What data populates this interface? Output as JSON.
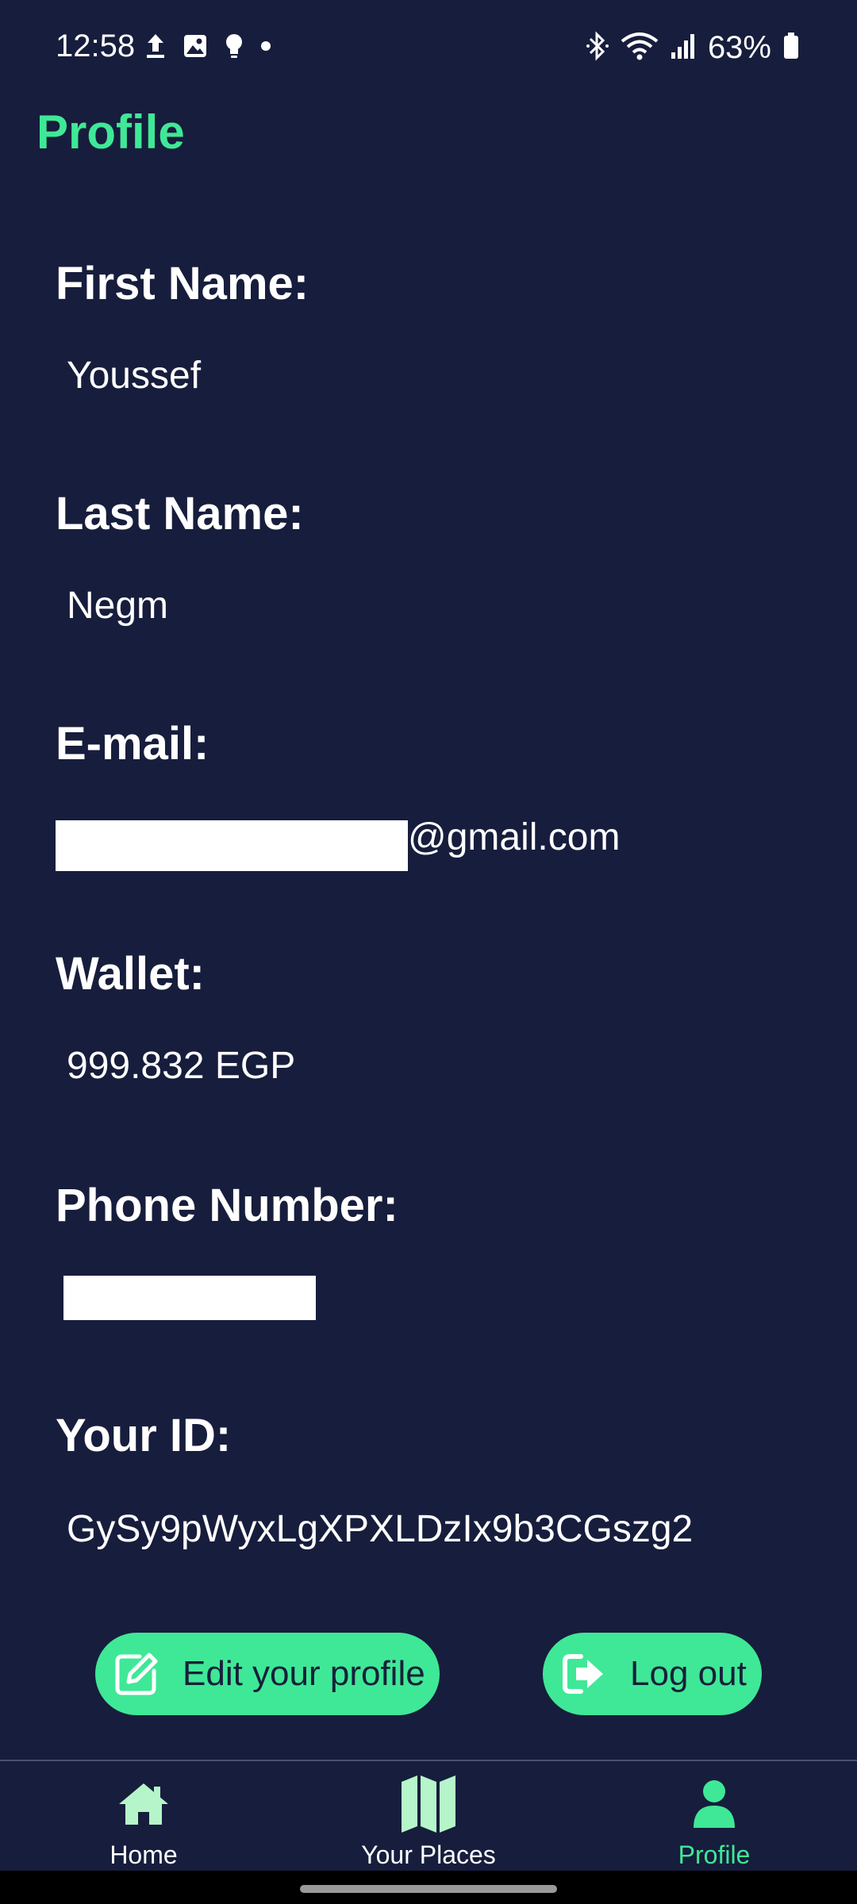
{
  "status_bar": {
    "time": "12:58",
    "battery": "63%",
    "icons_left": [
      "upload-icon",
      "image-icon",
      "bulb-icon",
      "dot-icon"
    ],
    "icons_right": [
      "bluetooth-icon",
      "wifi-icon",
      "signal-icon",
      "battery-icon"
    ]
  },
  "app_bar": {
    "title": "Profile"
  },
  "profile": {
    "first_name_label": "First Name:",
    "first_name": "Youssef",
    "last_name_label": "Last Name:",
    "last_name": "Negm",
    "email_label": "E-mail:",
    "email_suffix": "@gmail.com",
    "wallet_label": "Wallet:",
    "wallet": "999.832 EGP",
    "phone_label": "Phone Number:",
    "id_label": "Your ID:",
    "id": "GySy9pWyxLgXPXLDzIx9b3CGszg2"
  },
  "actions": {
    "edit_label": "Edit your profile",
    "logout_label": "Log out"
  },
  "bottom_nav": {
    "items": [
      {
        "label": "Home",
        "icon": "home-icon",
        "active": false
      },
      {
        "label": "Your Places",
        "icon": "map-icon",
        "active": false
      },
      {
        "label": "Profile",
        "icon": "person-icon",
        "active": true
      }
    ]
  },
  "colors": {
    "background": "#171d3c",
    "accent": "#3fe896",
    "nav_icon_inactive": "#b6f5c9",
    "text": "#ffffff"
  }
}
